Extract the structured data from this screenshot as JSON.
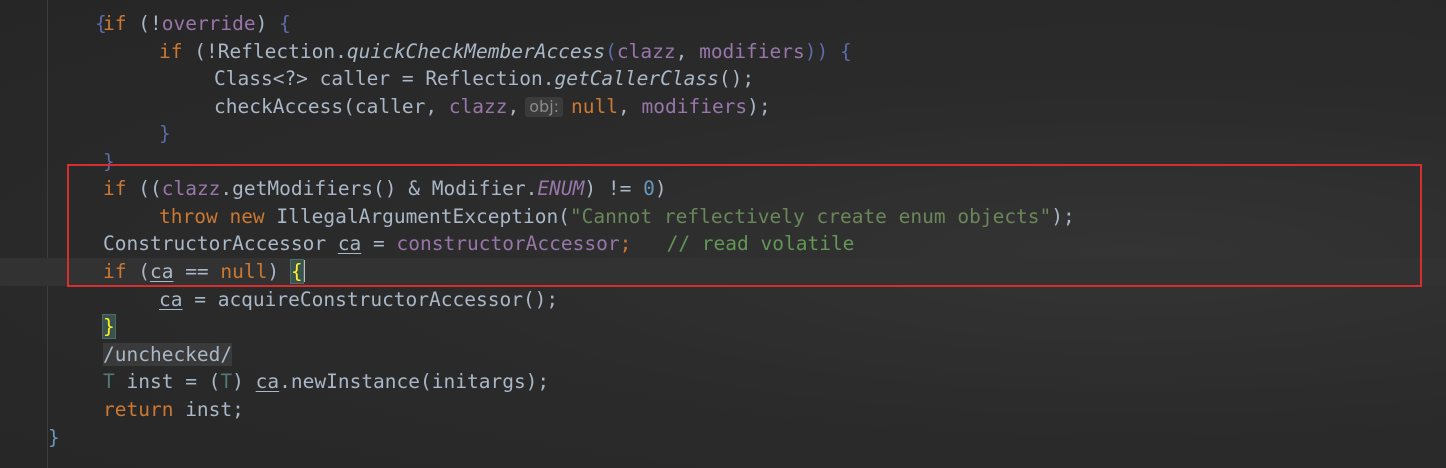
{
  "code": {
    "l1": {
      "kw": "if",
      "p1": " (!",
      "field": "override",
      "p2": ") ",
      "brace": "{"
    },
    "l2": {
      "kw": "if",
      "p1": " (!Reflection.",
      "method": "quickCheckMemberAccess",
      "p2": "(",
      "a1": "clazz",
      "p3": ", ",
      "a2": "modifiers",
      "p4": ")) ",
      "brace": "{"
    },
    "l3": {
      "t1": "Class<?> caller = Reflection.",
      "method": "getCallerClass",
      "t2": "();"
    },
    "l4": {
      "t1": "checkAccess(caller, ",
      "a1": "clazz",
      "t2": ",",
      "hint": "obj:",
      "nul": "null",
      "t3": ", ",
      "a2": "modifiers",
      "t4": ");"
    },
    "l5": {
      "brace": "}"
    },
    "l6": {
      "brace": "}"
    },
    "l7": {
      "kw": "if",
      "t1": " ((",
      "f1": "clazz",
      "t2": ".getModifiers() & Modifier.",
      "en": "ENUM",
      "t3": ") != ",
      "num": "0",
      "t4": ")"
    },
    "l8": {
      "kw1": "throw",
      "kw2": "new",
      "t1": " IllegalArgumentException(",
      "str": "\"Cannot reflectively create enum objects\"",
      "t2": ");"
    },
    "l9": {
      "t1": "ConstructorAccessor ",
      "var": "ca",
      "t2": " = ",
      "fld": "constructorAccessor",
      "t3": ";",
      "cmt": "// read volatile"
    },
    "l10": {
      "kw": "if",
      "t1": " (",
      "var": "ca",
      "t2": " == ",
      "nul": "null",
      "t3": ") ",
      "brace": "{"
    },
    "l11": {
      "var": "ca",
      "t1": " = acquireConstructorAccessor();"
    },
    "l12": {
      "brace": "}"
    },
    "l13": {
      "tag": "/unchecked/"
    },
    "l14": {
      "tp": "T",
      "t1": " inst = (",
      "tp2": "T",
      "t2": ") ",
      "var": "ca",
      "t3": ".newInstance(initargs);"
    },
    "l15": {
      "kw": "return",
      "t1": " inst;"
    },
    "l16": {
      "brace": "}"
    },
    "l0": {
      "brace": "{"
    }
  },
  "colors": {
    "keyword": "#cc7832",
    "field": "#9876aa",
    "string": "#6a8759",
    "comment": "#629755",
    "number": "#6897bb",
    "method_decl": "#ffc66d",
    "default_text": "#a9b7c6",
    "highlight_border": "#d32f2f"
  }
}
